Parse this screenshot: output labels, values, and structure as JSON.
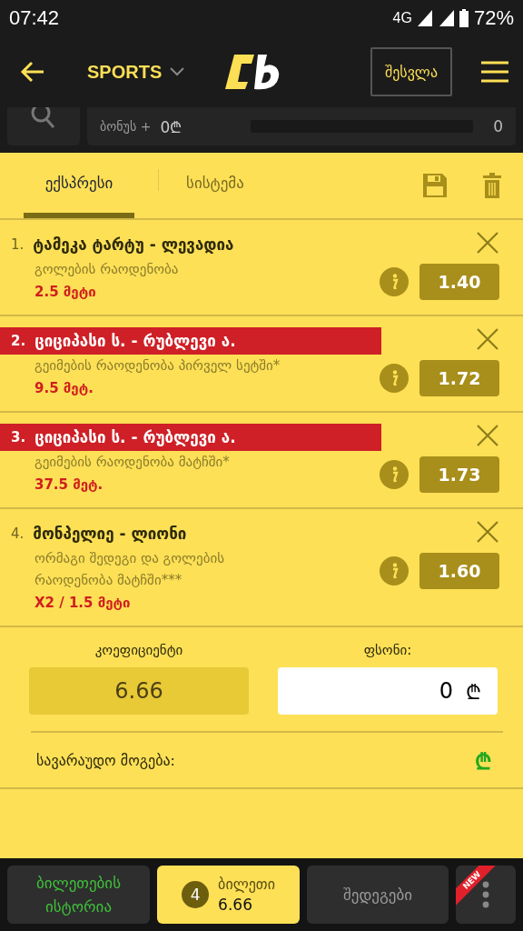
{
  "status_bar": {
    "time": "07:42",
    "network": "4G",
    "battery": "72%"
  },
  "header": {
    "sport": "SPORTS",
    "login": "შესვლა"
  },
  "bonus": {
    "label": "ბონუს +",
    "amount": "0₾",
    "level": 0,
    "count": "0"
  },
  "tabs": [
    {
      "label": "ექსპრესი",
      "selected": true
    },
    {
      "label": "სისტემა",
      "selected": false
    }
  ],
  "bets": [
    {
      "number": "1.",
      "match": "ტამეკა ტარტუ - ლევადია",
      "market": "გოლების რაოდენობა",
      "pick": "2.5 მეტი",
      "odds": "1.40",
      "warning": false
    },
    {
      "number": "2.",
      "match": "ციციპასი ს. - რუბლევი ა.",
      "market": "გეიმების რაოდენობა პირველ სეტში*",
      "pick": "9.5 მეტ.",
      "odds": "1.72",
      "warning": true
    },
    {
      "number": "3.",
      "match": "ციციპასი ს. - რუბლევი ა.",
      "market": "გეიმების რაოდენობა მატჩში*",
      "pick": "37.5 მეტ.",
      "odds": "1.73",
      "warning": true
    },
    {
      "number": "4.",
      "match": "მონპელიე - ლიონი",
      "market": "ორმაგი შედეგი და გოლების რაოდენობა მატჩში***",
      "pick": "X2 / 1.5 მეტი",
      "odds": "1.60",
      "warning": false
    }
  ],
  "totals": {
    "coef_label": "კოეფიციენტი",
    "coef_value": "6.66",
    "stake_label": "ფსონი:",
    "stake_value": "0",
    "currency": "₾",
    "win_label": "სავარაუდო მოგება:",
    "win_currency": "₾"
  },
  "bottom_nav": [
    {
      "kind": "history",
      "label": "ბილეთების ისტორია",
      "selected": false
    },
    {
      "kind": "ticket",
      "label": "ბილეთი",
      "count": "4",
      "value": "6.66",
      "selected": true
    },
    {
      "kind": "results",
      "label": "შედეგები",
      "selected": false
    },
    {
      "kind": "more",
      "badge": "NEW",
      "selected": false
    }
  ]
}
